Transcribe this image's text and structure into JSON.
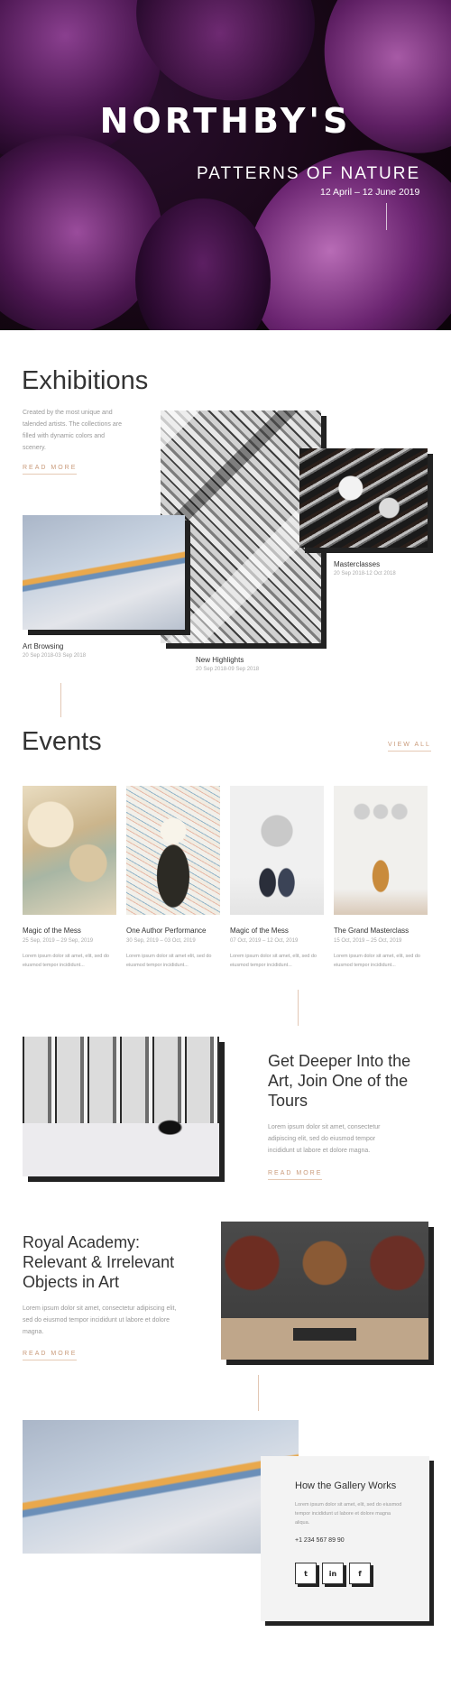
{
  "hero": {
    "brand": "NORTHBY'S",
    "subtitle": "PATTERNS OF NATURE",
    "dates": "12 April – 12 June 2019"
  },
  "exhibitions": {
    "title": "Exhibitions",
    "description": "Created by the most unique and talended artists. The collections are filled with dynamic colors and scenery.",
    "read_more": "READ MORE",
    "items": [
      {
        "name": "Masterclasses",
        "dates": "20 Sep 2018-12 Oct 2018"
      },
      {
        "name": "Art Browsing",
        "dates": "20 Sep 2018-03 Sep 2018"
      },
      {
        "name": "New Highlights",
        "dates": "20 Sep 2018-09 Sep 2018"
      }
    ]
  },
  "events": {
    "title": "Events",
    "view_all": "VIEW ALL",
    "items": [
      {
        "name": "Magic of the Mess",
        "dates": "25 Sep, 2019 – 29 Sep, 2019",
        "text": "Lorem ipsum dolor sit amet, elit, sed do eiusmod tempor incididunt..."
      },
      {
        "name": "One Author Performance",
        "dates": "30 Sep, 2019 – 03 Oct, 2019",
        "text": "Lorem ipsum dolor sit amet elit, sed do eiusmod tempor incididunt..."
      },
      {
        "name": "Magic of the Mess",
        "dates": "07 Oct, 2019 – 12 Oct, 2019",
        "text": "Lorem ipsum dolor sit amet, elit, sed do eiusmod tempor incididunt..."
      },
      {
        "name": "The Grand Masterclass",
        "dates": "15 Oct, 2019 – 25 Oct, 2019",
        "text": "Lorem ipsum dolor sit amet, elit, sed do eiusmod tempor incididunt..."
      }
    ]
  },
  "tours": {
    "title": "Get Deeper Into the Art, Join One of the Tours",
    "text": "Lorem ipsum dolor sit amet, consectetur adipiscing elit, sed do eiusmod tempor incididunt ut labore et dolore magna.",
    "read_more": "READ MORE"
  },
  "academy": {
    "title": "Royal Academy: Relevant & Irrelevant Objects in Art",
    "text": "Lorem ipsum dolor sit amet, consectetur adipiscing elit, sed do eiusmod tempor incididunt ut labore et dolore magna.",
    "read_more": "READ MORE"
  },
  "gallery": {
    "title": "How the Gallery Works",
    "text": "Lorem ipsum dolor sit amet, elit, sed do eiusmod tempor incididunt ut labore et dolore magna aliqua.",
    "phone": "+1 234 567 89 90",
    "social": [
      {
        "icon": "twitter-icon",
        "glyph": "t"
      },
      {
        "icon": "linkedin-icon",
        "glyph": "in"
      },
      {
        "icon": "facebook-icon",
        "glyph": "f"
      }
    ]
  }
}
